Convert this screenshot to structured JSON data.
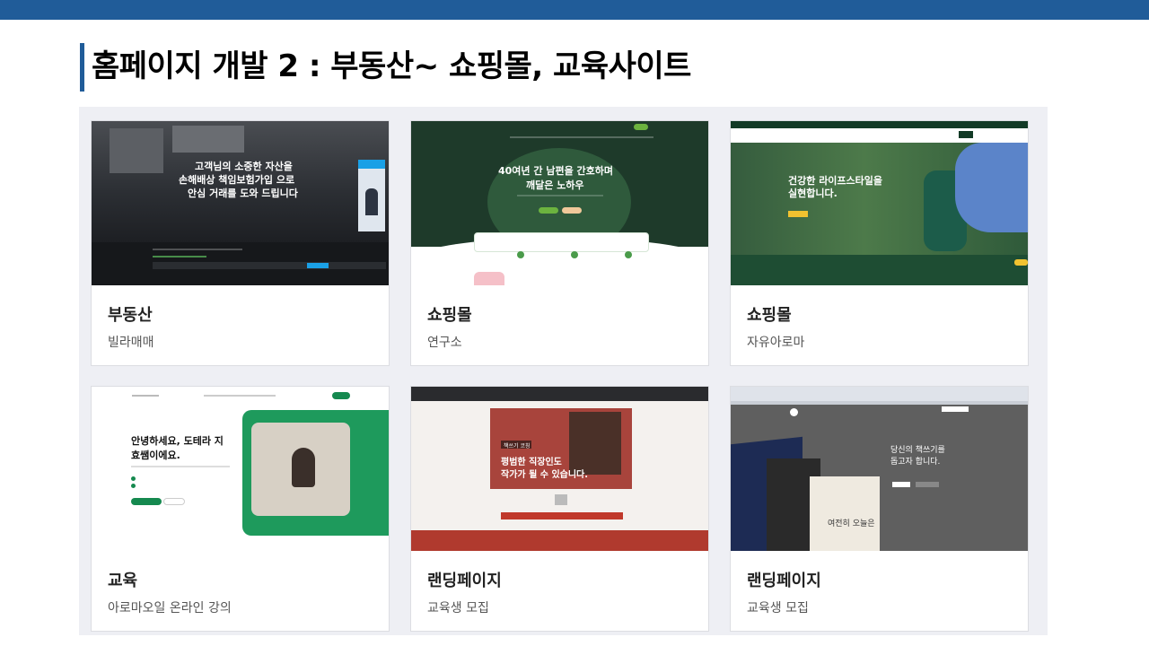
{
  "header": {
    "title": "홈페이지 개발 2 : 부동산~ 쇼핑몰, 교육사이트"
  },
  "colors": {
    "top_bar": "#205c99",
    "panel_bg": "#eeeff4"
  },
  "cards": [
    {
      "title": "부동산",
      "subtitle": "빌라매매",
      "thumb": {
        "line1": "고객님의 소중한 자산을",
        "line2": "손해배상 책임보험가입 으로",
        "line3": "안심 거래를 도와 드립니다"
      }
    },
    {
      "title": "쇼핑몰",
      "subtitle": "연구소",
      "thumb": {
        "line1": "40여년 간 남편을 간호하며",
        "line2": "깨달은 노하우"
      }
    },
    {
      "title": "쇼핑몰",
      "subtitle": "자유아로마",
      "thumb": {
        "line1": "건강한 라이프스타일을",
        "line2": "실현합니다."
      }
    },
    {
      "title": "교육",
      "subtitle": "아로마오일 온라인 강의",
      "thumb": {
        "line1": "안녕하세요, 도테라 지",
        "line2": "효쌤이에요."
      }
    },
    {
      "title": "랜딩페이지",
      "subtitle": "교육생 모집",
      "thumb": {
        "badge": "책쓰기 코칭",
        "line1": "평범한 직장인도",
        "line2": "작가가 될 수 있습니다."
      }
    },
    {
      "title": "랜딩페이지",
      "subtitle": "교육생 모집",
      "thumb": {
        "line1": "당신의 책쓰기를",
        "line2": "돕고자 합니다.",
        "book": "여전히 오늘은"
      }
    }
  ]
}
